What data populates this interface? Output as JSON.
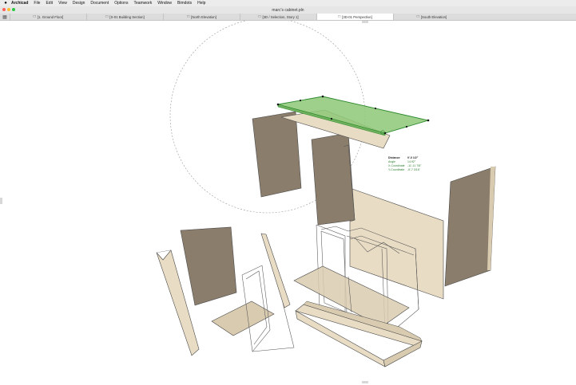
{
  "menubar": {
    "apple": "",
    "items": [
      "Archicad",
      "File",
      "Edit",
      "View",
      "Design",
      "Document",
      "Options",
      "Teamwork",
      "Window",
      "Bimdots",
      "Help"
    ]
  },
  "window": {
    "title": "marc's cabinet.pln"
  },
  "tabs": [
    {
      "label": "[1. Ground Floor]",
      "icon": "floor-plan-icon"
    },
    {
      "label": "[S-01 Building Section]",
      "icon": "section-icon"
    },
    {
      "label": "[North Elevation]",
      "icon": "elevation-icon"
    },
    {
      "label": "[3D / Selection, Story 1]",
      "icon": "3d-selection-icon"
    },
    {
      "label": "[3D-01 Perspective]",
      "icon": "3d-perspective-icon",
      "active": true
    },
    {
      "label": "[South Elevation]",
      "icon": "elevation-icon"
    }
  ],
  "tracker": [
    {
      "label": "Distance",
      "value": "0'-0 1/2\""
    },
    {
      "label": "Angle",
      "value": "14.92°"
    },
    {
      "label": "X-Coordinate",
      "value": "-11'-11 7/8\""
    },
    {
      "label": "Y-Coordinate",
      "value": "-5'-7 3/16\""
    }
  ],
  "colors": {
    "panel": "#e9dcc4",
    "panel_dark": "#8a7d6b",
    "selected": "#8dc878",
    "selected_stroke": "#2d8a2d",
    "edge": "#4a4a4a"
  }
}
